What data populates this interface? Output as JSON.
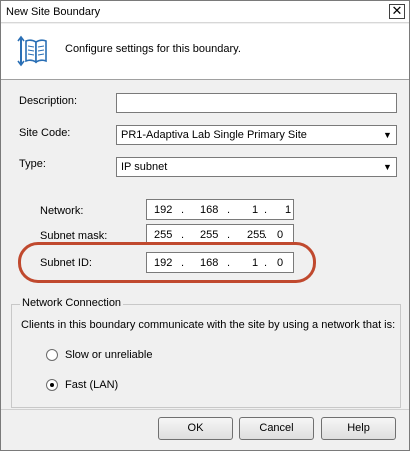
{
  "window": {
    "title": "New Site Boundary",
    "close_symbol": "✕"
  },
  "header": {
    "icon": "book-icon",
    "text": "Configure settings for this boundary."
  },
  "form": {
    "description_label": "Description:",
    "description_value": "",
    "site_code_label": "Site Code:",
    "site_code_value": "PR1-Adaptiva Lab Single Primary Site",
    "type_label": "Type:",
    "type_value": "IP subnet",
    "network_label": "Network:",
    "network_octets": [
      "192",
      "168",
      "1",
      "1"
    ],
    "subnet_mask_label": "Subnet mask:",
    "subnet_mask_octets": [
      "255",
      "255",
      "255",
      "0"
    ],
    "subnet_id_label": "Subnet ID:",
    "subnet_id_octets": [
      "192",
      "168",
      "1",
      "0"
    ],
    "ip_separator": "."
  },
  "network_connection": {
    "title": "Network Connection",
    "description": "Clients in this boundary communicate with the site by using a network that is:",
    "options": [
      "Slow or unreliable",
      "Fast (LAN)"
    ],
    "selected": "Fast (LAN)"
  },
  "buttons": {
    "ok": "OK",
    "cancel": "Cancel",
    "help": "Help"
  },
  "colors": {
    "highlight_ring": "#c0492e",
    "book_icon": "#2a6fb5"
  }
}
